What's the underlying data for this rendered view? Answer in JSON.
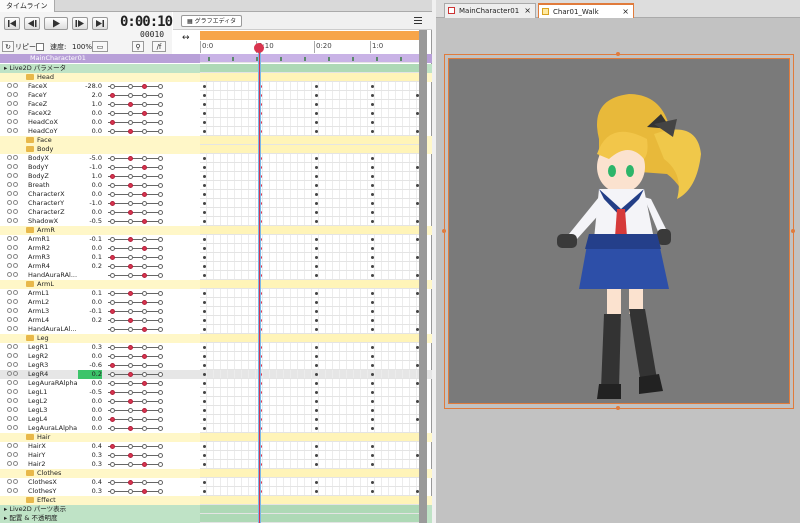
{
  "panel_title": "タイムライン",
  "controls": {
    "timecode": "0:00:10",
    "frame": "00010",
    "repeat_label": "リピート",
    "speed_label": "速度:",
    "speed_value": "100%"
  },
  "graph_editor_label": "グラフエディタ",
  "ruler_ticks": [
    "0:0",
    "0:10",
    "0:20",
    "1:0"
  ],
  "model_name": "MainCharacter01",
  "rows": [
    {
      "type": "section",
      "label": "Live2D パラメータ"
    },
    {
      "type": "group",
      "label": "Head"
    },
    {
      "type": "param",
      "label": "FaceX",
      "value": "-28.0"
    },
    {
      "type": "param",
      "label": "FaceY",
      "value": "2.0"
    },
    {
      "type": "param",
      "label": "FaceZ",
      "value": "1.0"
    },
    {
      "type": "param",
      "label": "FaceX2",
      "value": "0.0"
    },
    {
      "type": "param",
      "label": "HeadCoX",
      "value": "0.0"
    },
    {
      "type": "param",
      "label": "HeadCoY",
      "value": "0.0"
    },
    {
      "type": "group",
      "label": "Face"
    },
    {
      "type": "group",
      "label": "Body"
    },
    {
      "type": "param",
      "label": "BodyX",
      "value": "-5.0"
    },
    {
      "type": "param",
      "label": "BodyY",
      "value": "-1.0"
    },
    {
      "type": "param",
      "label": "BodyZ",
      "value": "1.0"
    },
    {
      "type": "param",
      "label": "Breath",
      "value": "0.0"
    },
    {
      "type": "param",
      "label": "CharacterX",
      "value": "0.0"
    },
    {
      "type": "param",
      "label": "CharacterY",
      "value": "-1.0"
    },
    {
      "type": "param",
      "label": "CharacterZ",
      "value": "0.0"
    },
    {
      "type": "param",
      "label": "ShadowX",
      "value": "-0.5"
    },
    {
      "type": "group",
      "label": "ArmR"
    },
    {
      "type": "param",
      "label": "ArmR1",
      "value": "-0.1"
    },
    {
      "type": "param",
      "label": "ArmR2",
      "value": "0.0"
    },
    {
      "type": "param",
      "label": "ArmR3",
      "value": "0.1"
    },
    {
      "type": "param",
      "label": "ArmR4",
      "value": "0.2"
    },
    {
      "type": "param",
      "label": "HandAuraRAl...",
      "value": ""
    },
    {
      "type": "group",
      "label": "ArmL"
    },
    {
      "type": "param",
      "label": "ArmL1",
      "value": "0.1"
    },
    {
      "type": "param",
      "label": "ArmL2",
      "value": "0.0"
    },
    {
      "type": "param",
      "label": "ArmL3",
      "value": "-0.1"
    },
    {
      "type": "param",
      "label": "ArmL4",
      "value": "0.2"
    },
    {
      "type": "param",
      "label": "HandAuraLAl...",
      "value": ""
    },
    {
      "type": "group",
      "label": "Leg"
    },
    {
      "type": "param",
      "label": "LegR1",
      "value": "0.3"
    },
    {
      "type": "param",
      "label": "LegR2",
      "value": "0.0"
    },
    {
      "type": "param",
      "label": "LegR3",
      "value": "-0.6"
    },
    {
      "type": "param",
      "label": "LegR4",
      "value": "0.2"
    },
    {
      "type": "param",
      "label": "LegAuraRAlpha",
      "value": "0.0"
    },
    {
      "type": "param",
      "label": "LegL1",
      "value": "-0.5"
    },
    {
      "type": "param",
      "label": "LegL2",
      "value": "0.0"
    },
    {
      "type": "param",
      "label": "LegL3",
      "value": "0.0"
    },
    {
      "type": "param",
      "label": "LegL4",
      "value": "0.0"
    },
    {
      "type": "param",
      "label": "LegAuraLAlpha",
      "value": "0.0"
    },
    {
      "type": "group",
      "label": "Hair"
    },
    {
      "type": "param",
      "label": "HairX",
      "value": "0.4"
    },
    {
      "type": "param",
      "label": "HairY",
      "value": "0.3"
    },
    {
      "type": "param",
      "label": "Hair2",
      "value": "0.3"
    },
    {
      "type": "group",
      "label": "Clothes"
    },
    {
      "type": "param",
      "label": "ClothesX",
      "value": "0.4"
    },
    {
      "type": "param",
      "label": "ClothesY",
      "value": "0.3"
    },
    {
      "type": "group",
      "label": "Effect"
    },
    {
      "type": "section",
      "label": "Live2D パーツ表示"
    },
    {
      "type": "section",
      "label": "配置 & 不透明度"
    }
  ],
  "tabs": [
    {
      "label": "MainCharacter01",
      "active": false
    },
    {
      "label": "Char01_Walk",
      "active": true
    }
  ],
  "colors": {
    "accent": "#e07b3c",
    "keyframe": "#d9344f",
    "model_row": "#b8a0d8",
    "selected_value": "#3cc46a"
  },
  "icons": [
    "rewind-start-icon",
    "step-back-icon",
    "play-icon",
    "step-forward-icon",
    "skip-end-icon",
    "menu-icon",
    "folder-icon",
    "keyframe-icon",
    "close-icon"
  ]
}
